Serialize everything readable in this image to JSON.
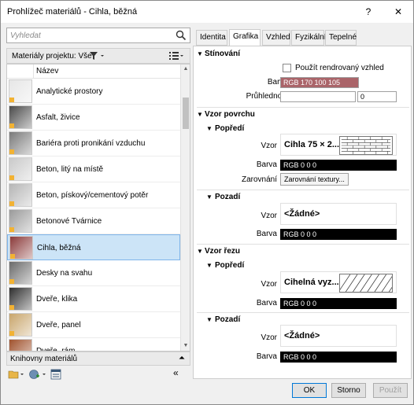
{
  "window": {
    "title": "Prohlížeč materiálů - Cihla, běžná",
    "help_label": "?",
    "close_label": "✕"
  },
  "left": {
    "search_placeholder": "Vyhledat",
    "project_label": "Materiály projektu: Vše",
    "column_header": "Název",
    "library_label": "Knihovny materiálů",
    "materials": [
      {
        "name": "Analytické prostory",
        "color": "#e6e6e6"
      },
      {
        "name": "Asfalt, živice",
        "color": "#4a4a4a"
      },
      {
        "name": "Bariéra proti pronikání vzduchu",
        "color": "#7a7a7a"
      },
      {
        "name": "Beton, litý na místě",
        "color": "#c9c9c9"
      },
      {
        "name": "Beton, pískový/cementový potěr",
        "color": "#b5b5b5"
      },
      {
        "name": "Betonové Tvárnice",
        "color": "#9a9a9a"
      },
      {
        "name": "Cihla, běžná",
        "color": "#8b3a3a"
      },
      {
        "name": "Desky na svahu",
        "color": "#6a6a6a"
      },
      {
        "name": "Dveře, klika",
        "color": "#2e2e2e"
      },
      {
        "name": "Dveře, panel",
        "color": "#c8a56b"
      },
      {
        "name": "Dveře, rám",
        "color": "#a0522d"
      }
    ]
  },
  "tabs": [
    "Identita",
    "Grafika",
    "Vzhled",
    "Fyzikální",
    "Tepelné"
  ],
  "active_tab": "Grafika",
  "graphics": {
    "shading_title": "Stínování",
    "use_render_label": "Použít rendrovaný vzhled",
    "color_label": "Barva",
    "shading_color": "RGB 170 100 105",
    "transparency_label": "Průhlednost",
    "transparency_value": "0",
    "surface_title": "Vzor povrchu",
    "foreground_title": "Popředí",
    "pattern_label": "Vzor",
    "surface_fg_pattern": "Cihla 75 × 2...",
    "surface_fg_color": "RGB 0 0 0",
    "alignment_label": "Zarovnání",
    "alignment_button": "Zarovnání textury...",
    "background_title": "Pozadí",
    "surface_bg_pattern": "<Žádné>",
    "surface_bg_color": "RGB 0 0 0",
    "cut_title": "Vzor řezu",
    "cut_fg_pattern": "Cihelná vyz...",
    "cut_fg_color": "RGB 0 0 0",
    "cut_bg_pattern": "<Žádné>",
    "cut_bg_color": "RGB 0 0 0"
  },
  "footer": {
    "ok": "OK",
    "cancel": "Storno",
    "apply": "Použít"
  }
}
